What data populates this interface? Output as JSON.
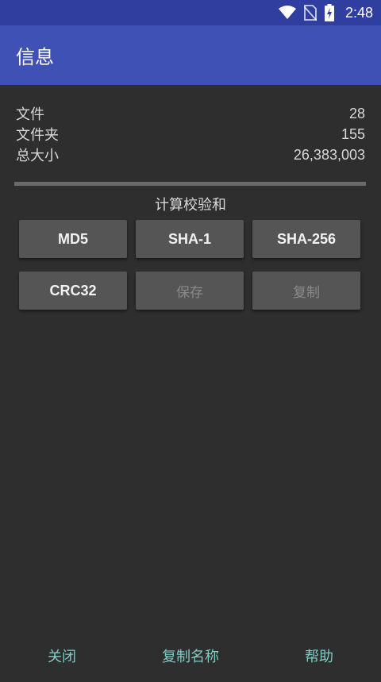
{
  "status_bar": {
    "time": "2:48",
    "icons": [
      "wifi-icon",
      "no-sim-icon",
      "battery-charging-icon"
    ]
  },
  "app_bar": {
    "title": "信息"
  },
  "info": [
    {
      "label": "文件",
      "value": "28"
    },
    {
      "label": "文件夹",
      "value": "155"
    },
    {
      "label": "总大小",
      "value": "26,383,003"
    }
  ],
  "checksum": {
    "title": "计算校验和",
    "md5": "MD5",
    "sha1": "SHA-1",
    "sha256": "SHA-256",
    "crc32": "CRC32",
    "save": "保存",
    "copy": "复制"
  },
  "footer": {
    "close": "关闭",
    "copy_name": "复制名称",
    "help": "帮助"
  },
  "colors": {
    "status_bar": "#303f9f",
    "app_bar": "#3f51b5",
    "background": "#2e2e2e",
    "accent": "#80cbc4"
  }
}
